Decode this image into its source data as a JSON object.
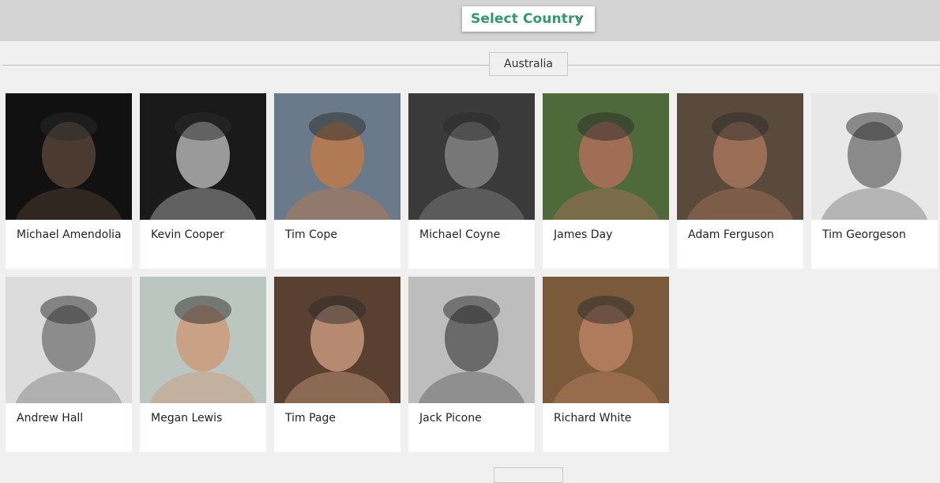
{
  "header": {
    "country_select_label": "Select Country",
    "country_select_icon": "chevron-down-icon"
  },
  "section": {
    "title": "Australia"
  },
  "photographers": [
    {
      "name": "Michael Amendolia",
      "tone": "#4a3a30",
      "bg": "#111111"
    },
    {
      "name": "Kevin Cooper",
      "tone": "#9a9a9a",
      "bg": "#1a1a1a"
    },
    {
      "name": "Tim Cope",
      "tone": "#b07a55",
      "bg": "#6a7a8a"
    },
    {
      "name": "Michael Coyne",
      "tone": "#777777",
      "bg": "#3a3a3a"
    },
    {
      "name": "James Day",
      "tone": "#a06e55",
      "bg": "#4f6a3a"
    },
    {
      "name": "Adam Ferguson",
      "tone": "#9a6e55",
      "bg": "#5a4a3c"
    },
    {
      "name": "Tim Georgeson",
      "tone": "#8a8a8a",
      "bg": "#e8e8e8"
    },
    {
      "name": "Andrew Hall",
      "tone": "#8c8c8c",
      "bg": "#dcdcdc"
    },
    {
      "name": "Megan Lewis",
      "tone": "#c9a184",
      "bg": "#bcc6c0"
    },
    {
      "name": "Tim Page",
      "tone": "#b58a70",
      "bg": "#5a4030"
    },
    {
      "name": "Jack Picone",
      "tone": "#6a6a6a",
      "bg": "#bdbdbd"
    },
    {
      "name": "Richard White",
      "tone": "#b07a5c",
      "bg": "#7a5a3a"
    }
  ]
}
